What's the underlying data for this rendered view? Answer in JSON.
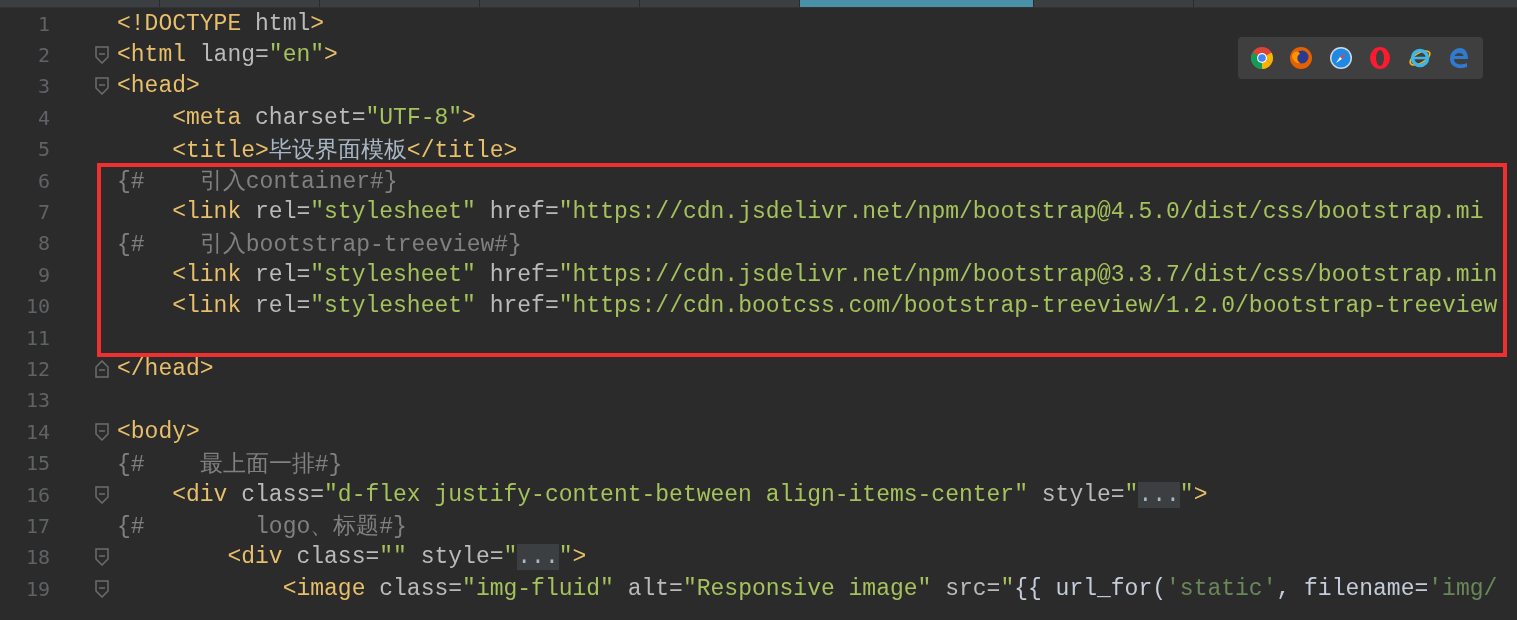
{
  "tabs": [
    {
      "selected": false
    },
    {
      "selected": false
    },
    {
      "selected": false
    },
    {
      "selected": false
    },
    {
      "selected": false
    },
    {
      "selected": true
    },
    {
      "selected": false
    }
  ],
  "browser_toolbar": {
    "browsers": [
      {
        "kind": "chrome"
      },
      {
        "kind": "firefox"
      },
      {
        "kind": "safari"
      },
      {
        "kind": "opera"
      },
      {
        "kind": "ie"
      },
      {
        "kind": "edge"
      }
    ]
  },
  "lines": [
    {
      "number": "1",
      "kind": "plain",
      "highlighted": false,
      "tokens": [
        {
          "kind": "tag",
          "text": "<!DOCTYPE"
        },
        {
          "kind": "attr",
          "text": " html"
        },
        {
          "kind": "tag",
          "text": ">"
        }
      ]
    },
    {
      "number": "2",
      "kind": "fold-start",
      "highlighted": false,
      "tokens": [
        {
          "kind": "tag",
          "text": "<html"
        },
        {
          "kind": "attr",
          "text": " lang="
        },
        {
          "kind": "string",
          "text": "\"en\""
        },
        {
          "kind": "tag",
          "text": ">"
        }
      ]
    },
    {
      "number": "3",
      "kind": "fold-start",
      "highlighted": false,
      "tokens": [
        {
          "kind": "tag",
          "text": "<head>"
        }
      ]
    },
    {
      "number": "4",
      "kind": "plain",
      "highlighted": false,
      "tokens": [
        {
          "kind": "tag",
          "text": "    <meta"
        },
        {
          "kind": "attr",
          "text": " charset="
        },
        {
          "kind": "string",
          "text": "\"UTF-8\""
        },
        {
          "kind": "tag",
          "text": ">"
        }
      ]
    },
    {
      "number": "5",
      "kind": "plain",
      "highlighted": false,
      "tokens": [
        {
          "kind": "tag",
          "text": "    <title>"
        },
        {
          "kind": "text",
          "text": "毕设界面模板"
        },
        {
          "kind": "tag",
          "text": "</title>"
        }
      ]
    },
    {
      "number": "6",
      "kind": "plain",
      "highlighted": true,
      "tokens": [
        {
          "kind": "comment",
          "text": "{#    引入container#}"
        }
      ]
    },
    {
      "number": "7",
      "kind": "plain",
      "highlighted": true,
      "tokens": [
        {
          "kind": "tag",
          "text": "    <link"
        },
        {
          "kind": "attr",
          "text": " rel="
        },
        {
          "kind": "string",
          "text": "\"stylesheet\""
        },
        {
          "kind": "attr",
          "text": " href="
        },
        {
          "kind": "string",
          "text": "\"https://cdn.jsdelivr.net/npm/bootstrap@4.5.0/dist/css/bootstrap.mi"
        }
      ]
    },
    {
      "number": "8",
      "kind": "plain",
      "highlighted": true,
      "tokens": [
        {
          "kind": "comment",
          "text": "{#    引入bootstrap-treeview#}"
        }
      ]
    },
    {
      "number": "9",
      "kind": "plain",
      "highlighted": true,
      "tokens": [
        {
          "kind": "tag",
          "text": "    <link"
        },
        {
          "kind": "attr",
          "text": " rel="
        },
        {
          "kind": "string",
          "text": "\"stylesheet\""
        },
        {
          "kind": "attr",
          "text": " href="
        },
        {
          "kind": "string",
          "text": "\"https://cdn.jsdelivr.net/npm/bootstrap@3.3.7/dist/css/bootstrap.min"
        }
      ]
    },
    {
      "number": "10",
      "kind": "plain",
      "highlighted": true,
      "tokens": [
        {
          "kind": "tag",
          "text": "    <link"
        },
        {
          "kind": "attr",
          "text": " rel="
        },
        {
          "kind": "string",
          "text": "\"stylesheet\""
        },
        {
          "kind": "attr",
          "text": " href="
        },
        {
          "kind": "string",
          "text": "\"https://cdn.bootcss.com/bootstrap-treeview/1.2.0/bootstrap-treeview"
        }
      ]
    },
    {
      "number": "11",
      "kind": "plain",
      "highlighted": true
    },
    {
      "number": "12",
      "kind": "fold-end",
      "highlighted": false,
      "tokens": [
        {
          "kind": "tag",
          "text": "</head>"
        }
      ]
    },
    {
      "number": "13",
      "kind": "plain",
      "highlighted": false
    },
    {
      "number": "14",
      "kind": "fold-start",
      "highlighted": false,
      "tokens": [
        {
          "kind": "tag",
          "text": "<body>"
        }
      ]
    },
    {
      "number": "15",
      "kind": "plain",
      "highlighted": false,
      "tokens": [
        {
          "kind": "comment",
          "text": "{#    最上面一排#}"
        }
      ]
    },
    {
      "number": "16",
      "kind": "fold-start",
      "highlighted": false,
      "tokens": [
        {
          "kind": "tag",
          "text": "    <div"
        },
        {
          "kind": "attr",
          "text": " class="
        },
        {
          "kind": "string",
          "text": "\"d-flex justify-content-between align-items-center\""
        },
        {
          "kind": "attr",
          "text": " style="
        },
        {
          "kind": "string",
          "text": "\""
        },
        {
          "kind": "folded",
          "text": "..."
        },
        {
          "kind": "string",
          "text": "\""
        },
        {
          "kind": "tag",
          "text": ">"
        }
      ]
    },
    {
      "number": "17",
      "kind": "plain",
      "highlighted": false,
      "tokens": [
        {
          "kind": "comment",
          "text": "{#        logo、标题#}"
        }
      ]
    },
    {
      "number": "18",
      "kind": "fold-start",
      "highlighted": false,
      "tokens": [
        {
          "kind": "tag",
          "text": "        <div"
        },
        {
          "kind": "attr",
          "text": " class="
        },
        {
          "kind": "string",
          "text": "\"\""
        },
        {
          "kind": "attr",
          "text": " style="
        },
        {
          "kind": "string",
          "text": "\""
        },
        {
          "kind": "folded",
          "text": "..."
        },
        {
          "kind": "string",
          "text": "\""
        },
        {
          "kind": "tag",
          "text": ">"
        }
      ]
    },
    {
      "number": "19",
      "kind": "fold-start",
      "highlighted": false,
      "tokens": [
        {
          "kind": "tag",
          "text": "            <image"
        },
        {
          "kind": "attr",
          "text": " class="
        },
        {
          "kind": "string",
          "text": "\"img-fluid\""
        },
        {
          "kind": "attr",
          "text": " alt="
        },
        {
          "kind": "string",
          "text": "\"Responsive image\""
        },
        {
          "kind": "attr",
          "text": " src="
        },
        {
          "kind": "string",
          "text": "\""
        },
        {
          "kind": "jinja",
          "text": "{{ url_for("
        },
        {
          "kind": "jstring",
          "text": "'static'"
        },
        {
          "kind": "jinja",
          "text": ", filename="
        },
        {
          "kind": "jstring",
          "text": "'img/"
        }
      ]
    }
  ]
}
